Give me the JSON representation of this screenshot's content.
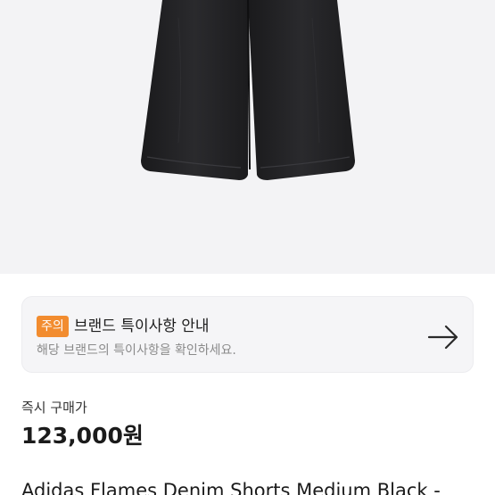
{
  "product_image": {
    "icon": "black-denim-shorts-photo",
    "background": "#f3f3f5"
  },
  "notice": {
    "badge": "주의",
    "title": "브랜드 특이사항 안내",
    "description": "해당 브랜드의 특이사항을 확인하세요.",
    "arrow_icon": "arrow-right-icon",
    "badge_color": "#f28c2f"
  },
  "price": {
    "label": "즉시 구매가",
    "value": "123,000원"
  },
  "product": {
    "name": "Adidas Flames Denim Shorts Medium Black -"
  }
}
